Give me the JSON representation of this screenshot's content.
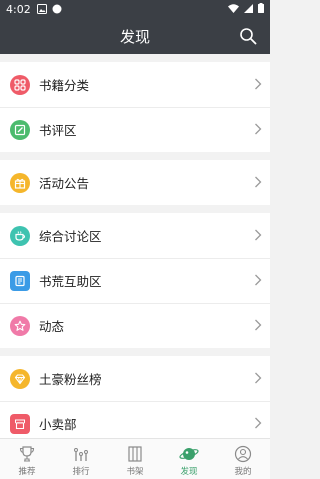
{
  "status_bar": {
    "time": "4:02"
  },
  "header": {
    "title": "发现"
  },
  "menu": {
    "groups": [
      [
        {
          "label": "书籍分类",
          "icon": "grid-icon",
          "color": "#ef5b68"
        },
        {
          "label": "书评区",
          "icon": "edit-icon",
          "color": "#4cbb6e"
        }
      ],
      [
        {
          "label": "活动公告",
          "icon": "gift-icon",
          "color": "#f5b62b"
        }
      ],
      [
        {
          "label": "综合讨论区",
          "icon": "cup-icon",
          "color": "#3ec3b0"
        },
        {
          "label": "书荒互助区",
          "icon": "book-help-icon",
          "color": "#3b9be6"
        },
        {
          "label": "动态",
          "icon": "star-icon",
          "color": "#f07aa8"
        }
      ],
      [
        {
          "label": "土豪粉丝榜",
          "icon": "diamond-icon",
          "color": "#f5b62b"
        },
        {
          "label": "小卖部",
          "icon": "shop-icon",
          "color": "#ef5b68"
        }
      ]
    ]
  },
  "tabs": [
    {
      "label": "推荐",
      "icon": "trophy-icon",
      "active": false
    },
    {
      "label": "排行",
      "icon": "ranking-icon",
      "active": false
    },
    {
      "label": "书架",
      "icon": "bookshelf-icon",
      "active": false
    },
    {
      "label": "发现",
      "icon": "planet-icon",
      "active": true
    },
    {
      "label": "我的",
      "icon": "profile-icon",
      "active": false
    }
  ],
  "colors": {
    "bar": "#3b3f45",
    "active_tab": "#3aa06b"
  }
}
